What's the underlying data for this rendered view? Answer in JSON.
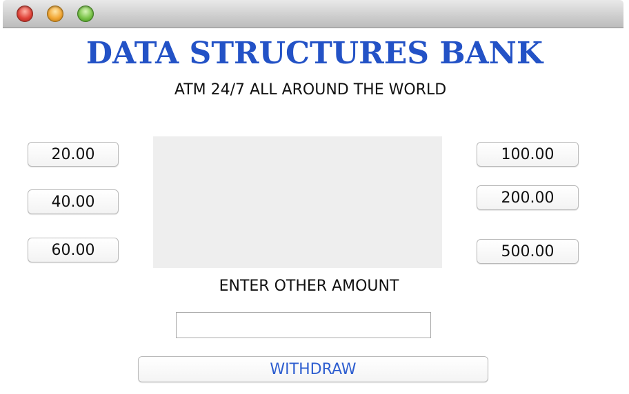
{
  "app": {
    "title": "DATA STRUCTURES BANK",
    "subtitle": "ATM 24/7 ALL AROUND THE WORLD"
  },
  "window": {
    "controls": [
      "close",
      "minimize",
      "zoom"
    ]
  },
  "amounts": {
    "left": [
      "20.00",
      "40.00",
      "60.00"
    ],
    "right": [
      "100.00",
      "200.00",
      "500.00"
    ]
  },
  "other_amount": {
    "label": "ENTER OTHER AMOUNT",
    "value": "",
    "placeholder": ""
  },
  "withdraw_label": "WITHDRAW",
  "colors": {
    "title": "#2352c6",
    "withdraw_text": "#2f5fd0",
    "display_panel": "#eeeeee"
  }
}
